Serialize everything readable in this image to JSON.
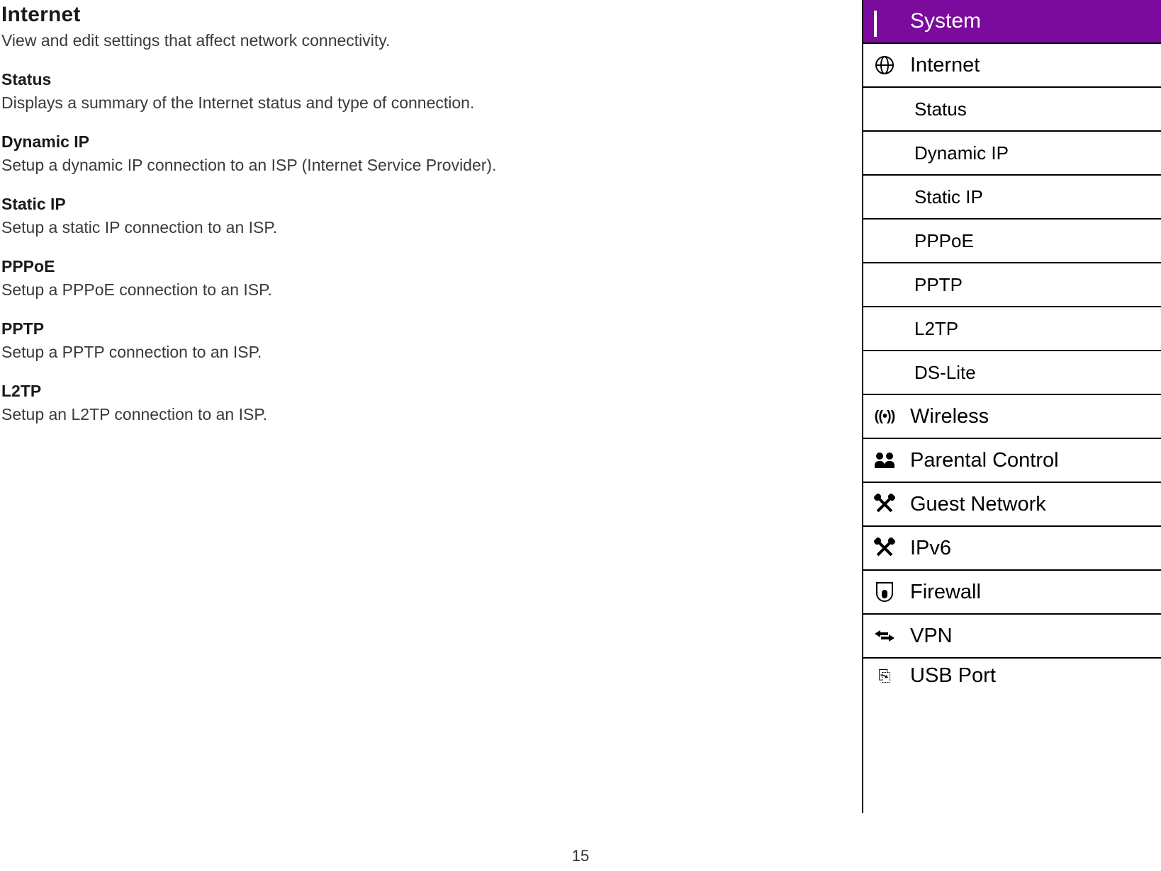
{
  "page_number": "15",
  "main": {
    "title": "Internet",
    "subtitle": "View and edit settings that affect network connectivity.",
    "sections": [
      {
        "title": "Status",
        "desc": "Displays a summary of the Internet status and type of connection."
      },
      {
        "title": "Dynamic IP",
        "desc": "Setup a dynamic IP connection to an ISP (Internet Service Provider)."
      },
      {
        "title": "Static IP",
        "desc": "Setup a static IP connection to an ISP."
      },
      {
        "title": "PPPoE",
        "desc": "Setup a PPPoE connection to an ISP."
      },
      {
        "title": "PPTP",
        "desc": "Setup a PPTP connection to an ISP."
      },
      {
        "title": "L2TP",
        "desc": "Setup an L2TP connection to an ISP."
      }
    ]
  },
  "menu": {
    "header": "System",
    "internet": "Internet",
    "subs": [
      "Status",
      "Dynamic IP",
      "Static IP",
      "PPPoE",
      "PPTP",
      "L2TP",
      "DS-Lite"
    ],
    "wireless": "Wireless",
    "parental": "Parental Control",
    "guest": "Guest Network",
    "ipv6": "IPv6",
    "firewall": "Firewall",
    "vpn": "VPN",
    "usb": "USB Port"
  }
}
